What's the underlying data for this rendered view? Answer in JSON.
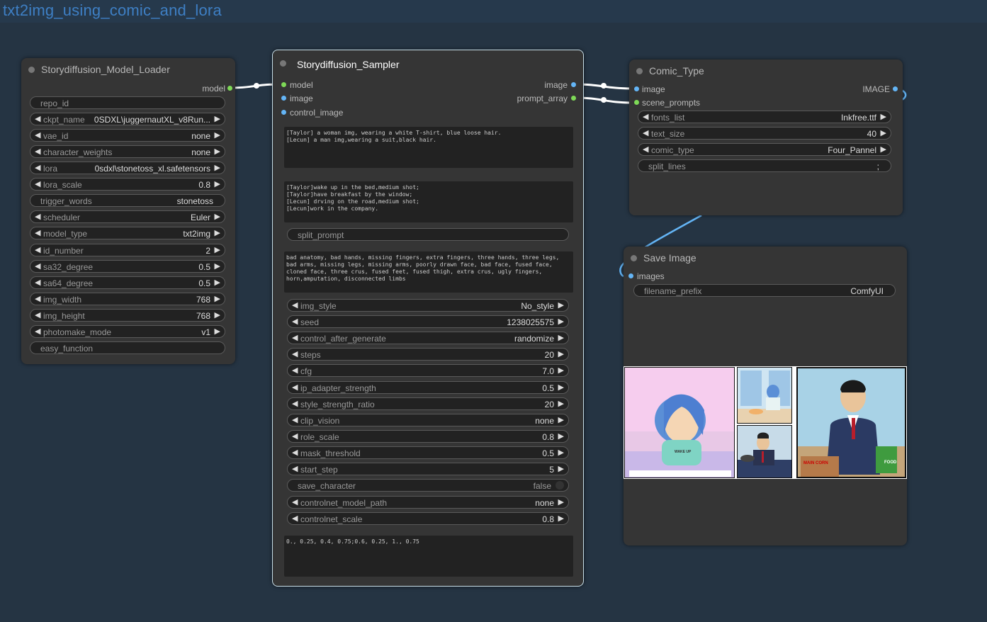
{
  "group_title": "txt2img_using_comic_and_lora",
  "loader": {
    "title": "Storydiffusion_Model_Loader",
    "output": "model",
    "widgets": [
      {
        "label": "repo_id",
        "value": ""
      },
      {
        "label": "ckpt_name",
        "value": "0SDXL\\juggernautXL_v8Run..."
      },
      {
        "label": "vae_id",
        "value": "none"
      },
      {
        "label": "character_weights",
        "value": "none"
      },
      {
        "label": "lora",
        "value": "0sdxl\\stonetoss_xl.safetensors"
      },
      {
        "label": "lora_scale",
        "value": "0.8"
      },
      {
        "label": "trigger_words",
        "value": "stonetoss"
      },
      {
        "label": "scheduler",
        "value": "Euler"
      },
      {
        "label": "model_type",
        "value": "txt2img"
      },
      {
        "label": "id_number",
        "value": "2"
      },
      {
        "label": "sa32_degree",
        "value": "0.5"
      },
      {
        "label": "sa64_degree",
        "value": "0.5"
      },
      {
        "label": "img_width",
        "value": "768"
      },
      {
        "label": "img_height",
        "value": "768"
      },
      {
        "label": "photomake_mode",
        "value": "v1"
      },
      {
        "label": "easy_function",
        "value": ""
      }
    ]
  },
  "sampler": {
    "title": "Storydiffusion_Sampler",
    "inputs": [
      "model",
      "image",
      "control_image"
    ],
    "outputs": [
      "image",
      "prompt_array"
    ],
    "character_prompt": "[Taylor] a woman img, wearing a white T-shirt, blue loose hair.\n[Lecun] a man img,wearing a suit,black hair.",
    "scene_prompt": "[Taylor]wake up in the bed,medium shot;\n[Taylor]have breakfast by the window;\n[Lecun] drving on the road,medium shot;\n[Lecun]work in the company.",
    "split_prompt_label": "split_prompt",
    "negative_prompt": "bad anatomy, bad hands, missing fingers, extra fingers, three hands, three legs,\nbad arms, missing legs, missing arms, poorly drawn face, bad face, fused face,\ncloned face, three crus, fused feet, fused thigh, extra crus, ugly fingers,\nhorn,amputation, disconnected limbs",
    "widgets": [
      {
        "label": "img_style",
        "value": "No_style"
      },
      {
        "label": "seed",
        "value": "1238025575"
      },
      {
        "label": "control_after_generate",
        "value": "randomize"
      },
      {
        "label": "steps",
        "value": "20"
      },
      {
        "label": "cfg",
        "value": "7.0"
      },
      {
        "label": "ip_adapter_strength",
        "value": "0.5"
      },
      {
        "label": "style_strength_ratio",
        "value": "20"
      },
      {
        "label": "clip_vision",
        "value": "none"
      },
      {
        "label": "role_scale",
        "value": "0.8"
      },
      {
        "label": "mask_threshold",
        "value": "0.5"
      },
      {
        "label": "start_step",
        "value": "5"
      },
      {
        "label": "save_character",
        "value": "false"
      },
      {
        "label": "controlnet_model_path",
        "value": "none"
      },
      {
        "label": "controlnet_scale",
        "value": "0.8"
      }
    ],
    "layout_text": "0., 0.25, 0.4, 0.75;0.6, 0.25, 1., 0.75"
  },
  "comic": {
    "title": "Comic_Type",
    "inputs": [
      "image",
      "scene_prompts"
    ],
    "output": "IMAGE",
    "widgets": [
      {
        "label": "fonts_list",
        "value": "Inkfree.ttf"
      },
      {
        "label": "text_size",
        "value": "40"
      },
      {
        "label": "comic_type",
        "value": "Four_Pannel"
      },
      {
        "label": "split_lines",
        "value": ";"
      }
    ]
  },
  "save": {
    "title": "Save Image",
    "input": "images",
    "widget": {
      "label": "filename_prefix",
      "value": "ComfyUI"
    },
    "panel_captions": [
      "WAKE UP",
      "MAIN CORN",
      "FOOD"
    ]
  },
  "colors": {
    "canvas": "#1f2a33",
    "group_title": "#3e7fc4",
    "node_bg": "#353535",
    "model_slot": "#7ed957",
    "image_slot": "#64b5f6",
    "wire": "#ffffff",
    "image_wire": "#64b5f6"
  }
}
